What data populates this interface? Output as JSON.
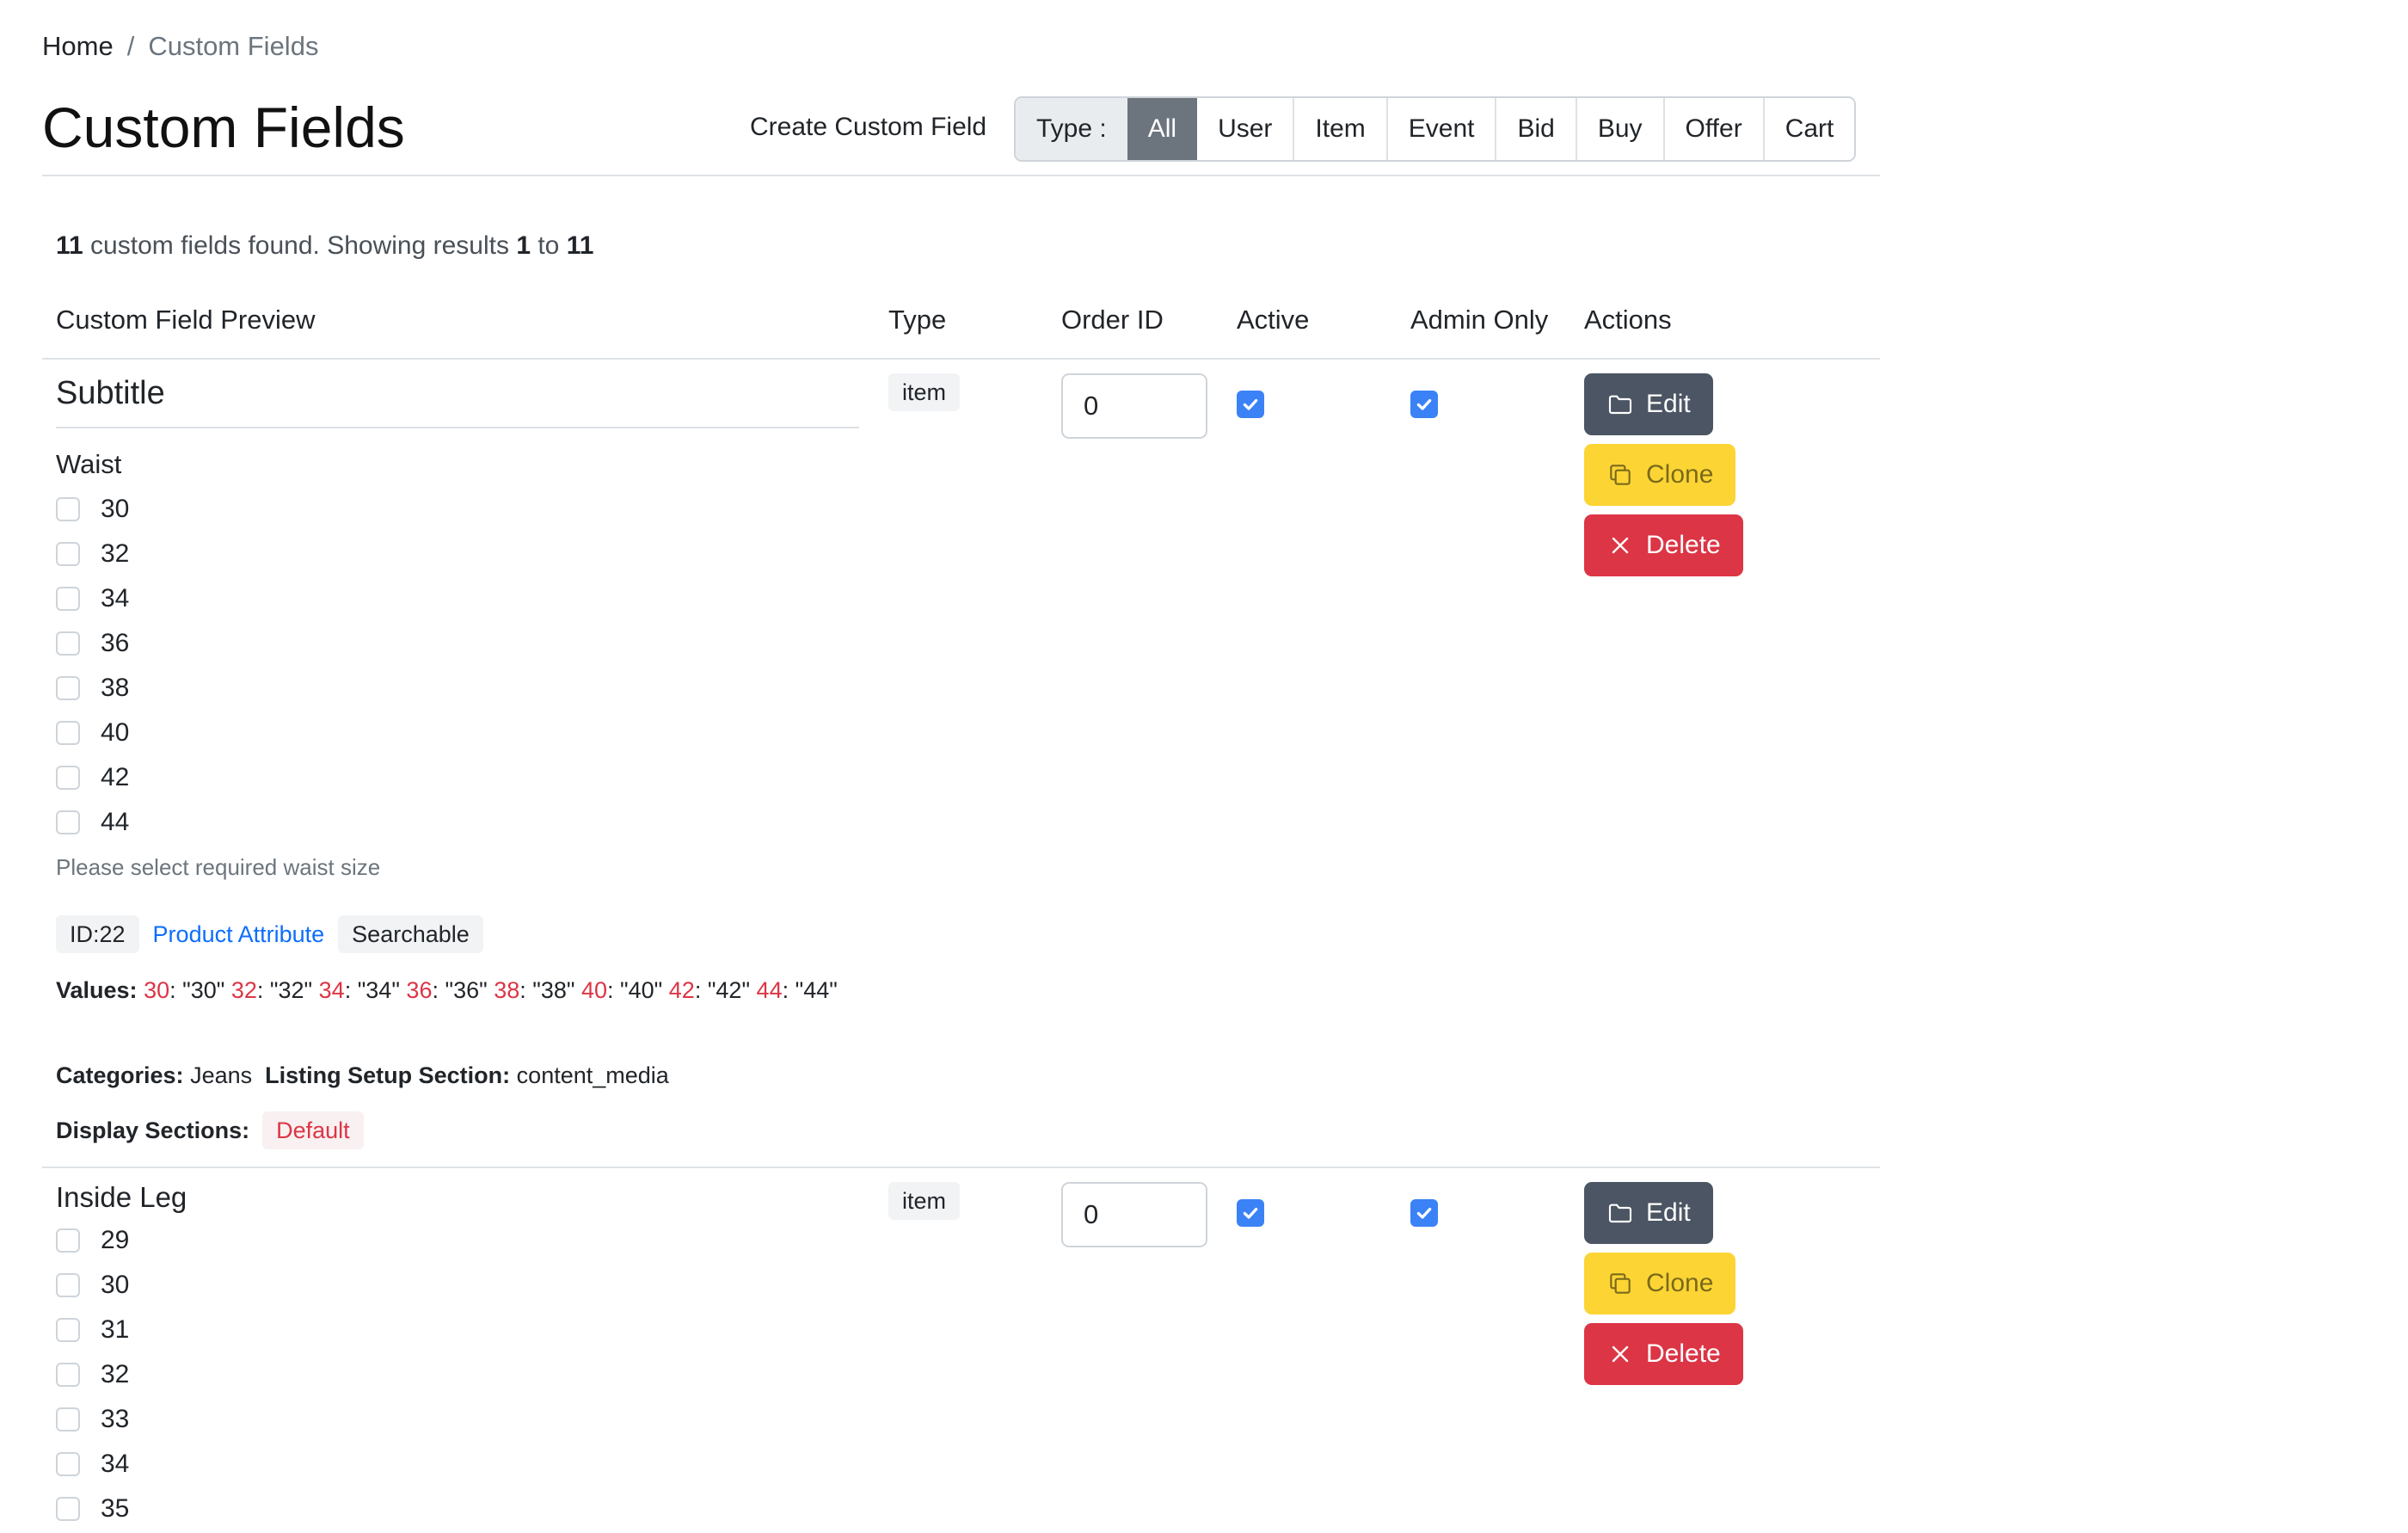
{
  "breadcrumb": {
    "home": "Home",
    "separator": "/",
    "current": "Custom Fields"
  },
  "header": {
    "title": "Custom Fields",
    "create_label": "Create Custom Field",
    "type_filter": {
      "label": "Type :",
      "options": [
        "All",
        "User",
        "Item",
        "Event",
        "Bid",
        "Buy",
        "Offer",
        "Cart"
      ],
      "selected": "All"
    }
  },
  "summary": {
    "count": "11",
    "text1": " custom fields found. Showing results ",
    "from": "1",
    "text2": " to ",
    "to": "11"
  },
  "table": {
    "columns": [
      "Custom Field Preview",
      "Type",
      "Order ID",
      "Active",
      "Admin Only",
      "Actions"
    ],
    "actions": {
      "edit": "Edit",
      "clone": "Clone",
      "delete": "Delete"
    },
    "rows": [
      {
        "subtitle": "Subtitle",
        "label": "Waist",
        "options": [
          "30",
          "32",
          "34",
          "36",
          "38",
          "40",
          "42",
          "44"
        ],
        "help": "Please select required waist size",
        "id_badge": "ID:22",
        "attribute_link": "Product Attribute",
        "searchable": "Searchable",
        "values_label": "Values:",
        "values": [
          {
            "key": "30",
            "val": "\"30\""
          },
          {
            "key": "32",
            "val": "\"32\""
          },
          {
            "key": "34",
            "val": "\"34\""
          },
          {
            "key": "36",
            "val": "\"36\""
          },
          {
            "key": "38",
            "val": "\"38\""
          },
          {
            "key": "40",
            "val": "\"40\""
          },
          {
            "key": "42",
            "val": "\"42\""
          },
          {
            "key": "44",
            "val": "\"44\""
          }
        ],
        "categories_label": "Categories:",
        "categories": "Jeans",
        "listing_label": "Listing Setup Section:",
        "listing": "content_media",
        "display_label": "Display Sections:",
        "display": "Default",
        "type": "item",
        "order_id": "0",
        "active": true,
        "admin_only": true
      },
      {
        "label": "Inside Leg",
        "options": [
          "29",
          "30",
          "31",
          "32",
          "33",
          "34",
          "35"
        ],
        "type": "item",
        "order_id": "0",
        "active": true,
        "admin_only": true
      }
    ]
  },
  "colors": {
    "primary": "#3b82f6",
    "edit": "#4b5563",
    "clone": "#fcd535",
    "delete": "#dc3545"
  },
  "icons": {
    "edit": "folder-icon",
    "clone": "copy-icon",
    "delete": "x-icon",
    "check": "check-icon"
  }
}
